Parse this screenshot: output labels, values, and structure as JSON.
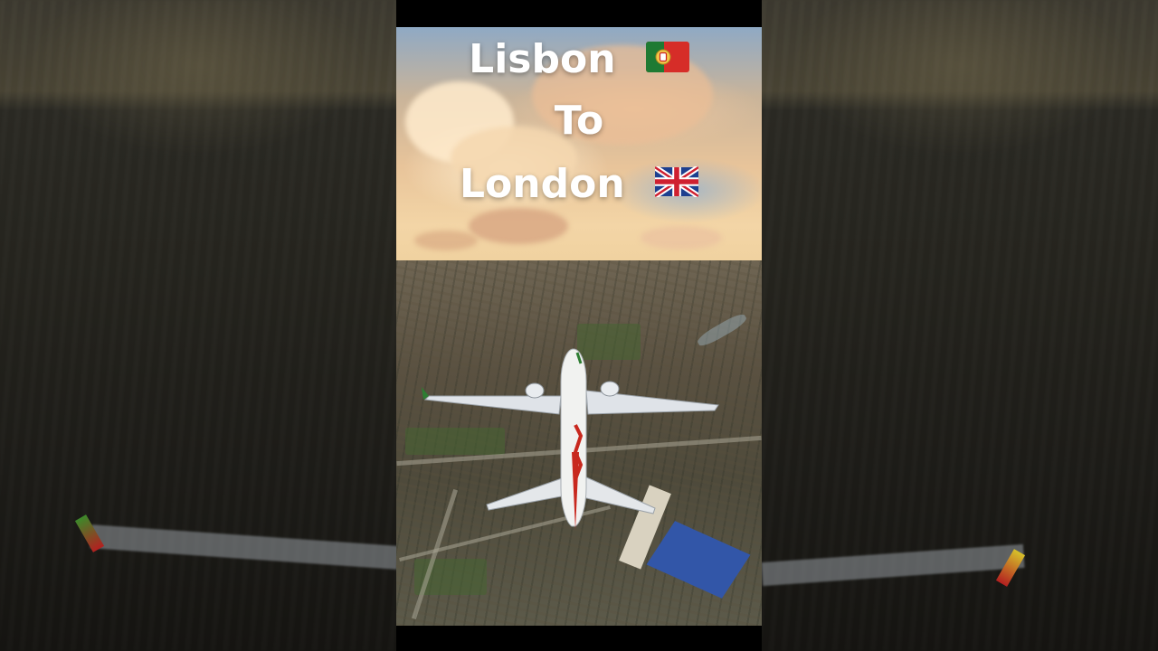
{
  "overlay": {
    "line1": "Lisbon",
    "line2": "To",
    "line3": "London"
  },
  "icons": {
    "flag1": "portugal-flag-icon",
    "flag2": "united-kingdom-flag-icon"
  },
  "colors": {
    "title_text": "#ffffff",
    "letterbox": "#000000",
    "livery_red": "#c8281e",
    "livery_green": "#2e7d32"
  }
}
